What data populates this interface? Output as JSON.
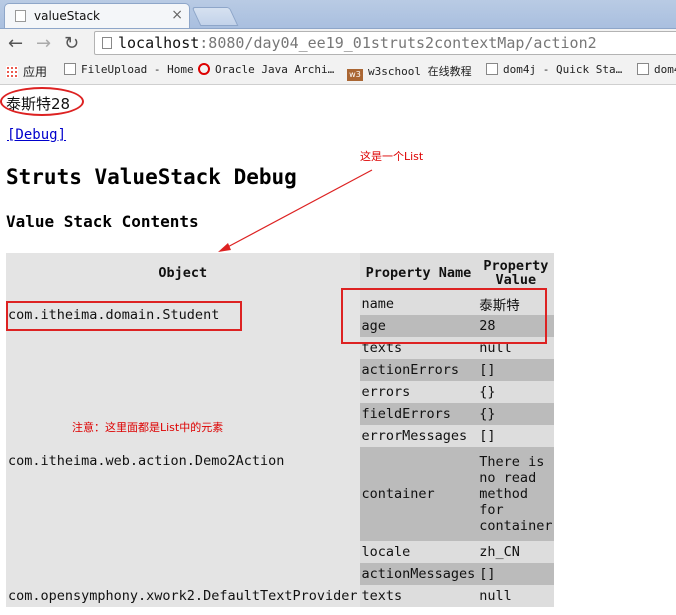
{
  "browser": {
    "tab_title": "valueStack",
    "url_host": "localhost",
    "url_rest": ":8080/day04_ee19_01struts2contextMap/action2",
    "bookmarks": [
      "应用",
      "FileUpload - Home",
      "Oracle Java Archi…",
      "w3school 在线教程",
      "dom4j - Quick Sta…",
      "dom4"
    ]
  },
  "page": {
    "result_text": "泰斯特28",
    "debug_link": "[Debug]",
    "heading": "Struts ValueStack Debug",
    "subheading": "Value Stack Contents"
  },
  "table": {
    "headers": {
      "object": "Object",
      "property_name": "Property Name",
      "property_value": "Property Value"
    },
    "groups": [
      {
        "object": "com.itheima.domain.Student",
        "rows": [
          {
            "name": "name",
            "value": "泰斯特"
          },
          {
            "name": "age",
            "value": "28"
          }
        ]
      },
      {
        "object": "com.itheima.web.action.Demo2Action",
        "rows": [
          {
            "name": "texts",
            "value": "null"
          },
          {
            "name": "actionErrors",
            "value": "[]"
          },
          {
            "name": "errors",
            "value": "{}"
          },
          {
            "name": "fieldErrors",
            "value": "{}"
          },
          {
            "name": "errorMessages",
            "value": "[]"
          },
          {
            "name": "container",
            "value": "There is no read method for container"
          },
          {
            "name": "locale",
            "value": "zh_CN"
          },
          {
            "name": "actionMessages",
            "value": "[]"
          }
        ]
      },
      {
        "object": "com.opensymphony.xwork2.DefaultTextProvider",
        "rows": [
          {
            "name": "texts",
            "value": "null"
          }
        ]
      }
    ]
  },
  "annotations": {
    "list_label": "这是一个List",
    "note": "注意：这里面都是List中的元素",
    "color": "#dd2222"
  }
}
